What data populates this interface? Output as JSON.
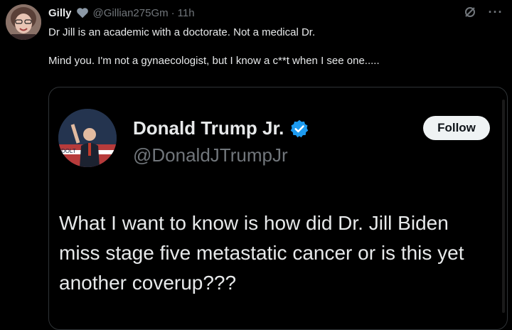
{
  "tweet": {
    "author_name": "Gilly",
    "author_handle": "@Gillian275Gm",
    "separator": "·",
    "time": "11h",
    "more_label": "···",
    "paragraphs": [
      "Dr Jill is an academic with a doctorate. Not a medical Dr.",
      "Mind you. I'm not a gynaecologist, but I know a c**t when I see one....."
    ]
  },
  "quoted": {
    "author_name": "Donald Trump Jr.",
    "author_handle": "@DonaldJTrumpJr",
    "follow_label": "Follow",
    "text": "What I want to know is how did Dr. Jill Biden miss stage five metastatic cancer or is this yet another coverup???"
  },
  "icons": {
    "heart": "heart-icon",
    "grok": "grok-icon",
    "more": "more-icon",
    "verified": "verified-badge-icon"
  },
  "colors": {
    "background": "#000000",
    "text": "#e7e9ea",
    "secondary": "#71767b",
    "verified": "#1d9bf0",
    "follow_bg": "#eff3f4"
  }
}
